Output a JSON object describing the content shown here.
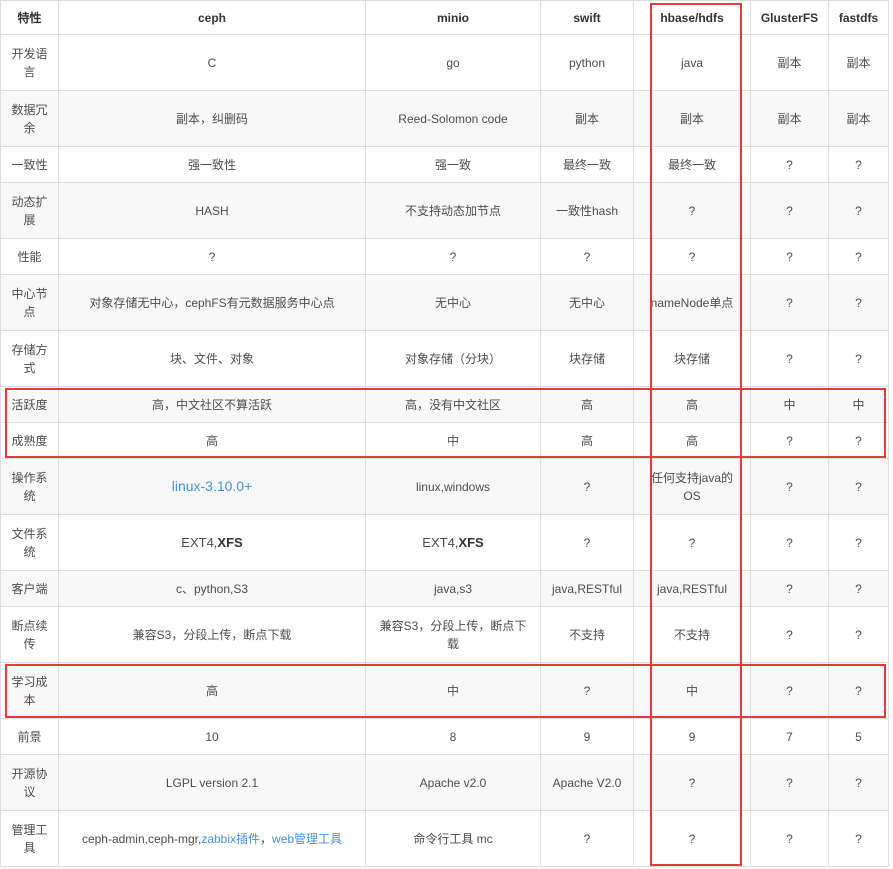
{
  "columns": [
    "特性",
    "ceph",
    "minio",
    "swift",
    "hbase/hdfs",
    "GlusterFS",
    "fastdfs"
  ],
  "rows": [
    {
      "feature": "开发语言",
      "ceph": "C",
      "minio": "go",
      "swift": "python",
      "hbase_hdfs": "java",
      "glusterfs": "副本",
      "fastdfs": "副本"
    },
    {
      "feature": "数据冗余",
      "ceph": "副本，纠删码",
      "minio": "Reed-Solomon code",
      "swift": "副本",
      "hbase_hdfs": "副本",
      "glusterfs": "副本",
      "fastdfs": "副本"
    },
    {
      "feature": "一致性",
      "ceph": "强一致性",
      "minio": "强一致",
      "swift": "最终一致",
      "hbase_hdfs": "最终一致",
      "glusterfs": "?",
      "fastdfs": "?"
    },
    {
      "feature": "动态扩展",
      "ceph": "HASH",
      "minio": "不支持动态加节点",
      "swift": "一致性hash",
      "hbase_hdfs": "?",
      "glusterfs": "?",
      "fastdfs": "?"
    },
    {
      "feature": "性能",
      "ceph": "?",
      "minio": "?",
      "swift": "?",
      "hbase_hdfs": "?",
      "glusterfs": "?",
      "fastdfs": "?"
    },
    {
      "feature": "中心节点",
      "ceph": "对象存储无中心，cephFS有元数据服务中心点",
      "minio": "无中心",
      "swift": "无中心",
      "hbase_hdfs": "nameNode单点",
      "glusterfs": "?",
      "fastdfs": "?"
    },
    {
      "feature": "存储方式",
      "ceph": "块、文件、对象",
      "minio": "对象存储（分块）",
      "swift": "块存储",
      "hbase_hdfs": "块存储",
      "glusterfs": "?",
      "fastdfs": "?"
    },
    {
      "feature": "活跃度",
      "ceph": "高，中文社区不算活跃",
      "minio": "高，没有中文社区",
      "swift": "高",
      "hbase_hdfs": "高",
      "glusterfs": "中",
      "fastdfs": "中"
    },
    {
      "feature": "成熟度",
      "ceph": "高",
      "minio": "中",
      "swift": "高",
      "hbase_hdfs": "高",
      "glusterfs": "?",
      "fastdfs": "?"
    },
    {
      "feature": "操作系统",
      "ceph": "linux-3.10.0+",
      "minio": "linux,windows",
      "swift": "?",
      "hbase_hdfs": "任何支持java的OS",
      "glusterfs": "?",
      "fastdfs": "?"
    },
    {
      "feature": "文件系统",
      "ceph": {
        "text": "EXT4,",
        "bold": "XFS"
      },
      "minio": {
        "text": "EXT4,",
        "bold": "XFS"
      },
      "swift": "?",
      "hbase_hdfs": "?",
      "glusterfs": "?",
      "fastdfs": "?"
    },
    {
      "feature": "客户端",
      "ceph": "c、python,S3",
      "minio": "java,s3",
      "swift": "java,RESTful",
      "hbase_hdfs": "java,RESTful",
      "glusterfs": "?",
      "fastdfs": "?"
    },
    {
      "feature": "断点续传",
      "ceph": "兼容S3，分段上传，断点下载",
      "minio": "兼容S3，分段上传，断点下载",
      "swift": "不支持",
      "hbase_hdfs": "不支持",
      "glusterfs": "?",
      "fastdfs": "?"
    },
    {
      "feature": "学习成本",
      "ceph": "高",
      "minio": "中",
      "swift": "?",
      "hbase_hdfs": "中",
      "glusterfs": "?",
      "fastdfs": "?"
    },
    {
      "feature": "前景",
      "ceph": 10,
      "minio": 8,
      "swift": 9,
      "hbase_hdfs": 9,
      "glusterfs": 7,
      "fastdfs": 5
    },
    {
      "feature": "开源协议",
      "ceph": "LGPL version 2.1",
      "minio": "Apache v2.0",
      "swift": "Apache V2.0",
      "hbase_hdfs": "?",
      "glusterfs": "?",
      "fastdfs": "?"
    },
    {
      "feature": "管理工具",
      "ceph": {
        "text": "ceph-admin,ceph-mgr,",
        "link1": "zabbix插件",
        "sep": "，",
        "link2": "web管理工具"
      },
      "minio": "命令行工具 mc",
      "swift": "?",
      "hbase_hdfs": "?",
      "glusterfs": "?",
      "fastdfs": "?"
    }
  ],
  "highlights": [
    {
      "column": "hbase/hdfs"
    },
    {
      "rows": [
        "活跃度",
        "成熟度"
      ]
    },
    {
      "rows": [
        "学习成本"
      ]
    }
  ],
  "colors": {
    "text": "#4d4d4d",
    "header": "#333333",
    "link": "#4393df",
    "border": "#dddddd",
    "alt": "#f8f8f8",
    "annot": "#e8393b",
    "bg": "#ffffff"
  }
}
